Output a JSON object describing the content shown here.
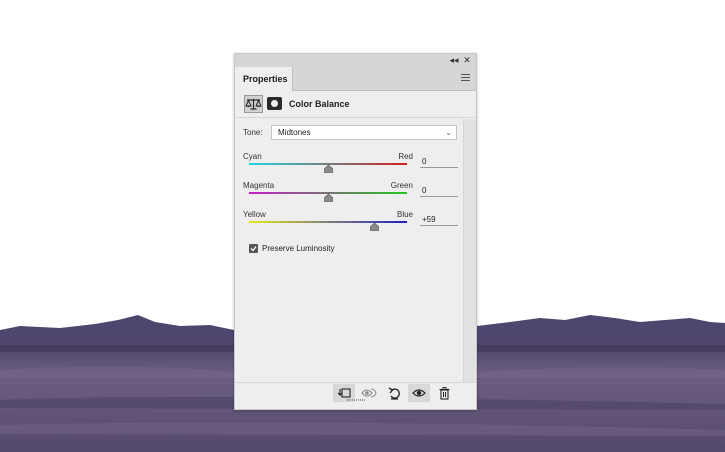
{
  "panel": {
    "title_buttons": {
      "collapse": "◂◂",
      "close": "✕"
    },
    "tab_label": "Properties",
    "menu_icon": "hamburger-menu-icon"
  },
  "adjustment": {
    "title": "Color Balance",
    "icon": "color-balance-scales-icon",
    "mask_icon": "layer-mask-icon"
  },
  "tone": {
    "label": "Tone:",
    "value": "Midtones"
  },
  "sliders": [
    {
      "left": "Cyan",
      "right": "Red",
      "value": "0",
      "level": 0,
      "colors": [
        "#1fd8e0",
        "#d21e1e"
      ]
    },
    {
      "left": "Magenta",
      "right": "Green",
      "value": "0",
      "level": 0,
      "colors": [
        "#c81ec8",
        "#22c81e"
      ]
    },
    {
      "left": "Yellow",
      "right": "Blue",
      "value": "+59",
      "level": 59,
      "colors": [
        "#e6e61e",
        "#1e1ec8"
      ]
    }
  ],
  "preserve_luminosity": {
    "label": "Preserve Luminosity",
    "checked": true
  },
  "bottom_toolbar": [
    {
      "name": "clip-to-layer-icon",
      "active": true
    },
    {
      "name": "view-previous-state-icon",
      "active": false
    },
    {
      "name": "reset-icon",
      "active": false
    },
    {
      "name": "visibility-eye-icon",
      "active": true
    },
    {
      "name": "trash-icon",
      "active": false
    }
  ],
  "colors": {
    "panel_bg": "#eeeeee",
    "panel_chrome": "#d6d6d6",
    "mountain": "#5e5478",
    "ground": "#6c5f82"
  }
}
